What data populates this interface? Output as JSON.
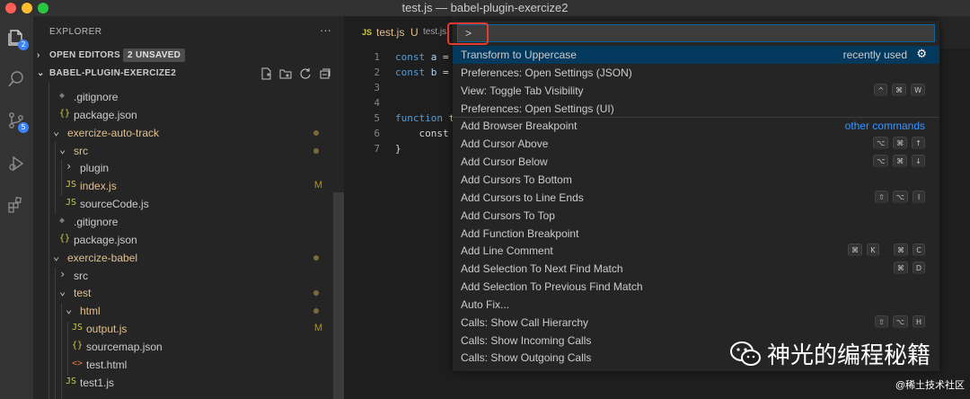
{
  "window": {
    "title": "test.js — babel-plugin-exercize2"
  },
  "activity_bar": {
    "explorer_badge": "2",
    "scm_badge": "5"
  },
  "sidebar": {
    "header": "EXPLORER",
    "more": "···",
    "open_editors": {
      "label": "OPEN EDITORS",
      "badge": "2 UNSAVED"
    },
    "project": {
      "label": "BABEL-PLUGIN-EXERCIZE2"
    },
    "tree": [
      {
        "name": ".gitignore",
        "icon": "◆",
        "icon_color": "#7a7a7a",
        "depth": 1,
        "color": "#cccccc"
      },
      {
        "name": "package.json",
        "icon": "{}",
        "icon_color": "#cbcb41",
        "depth": 1,
        "color": "#cccccc"
      },
      {
        "name": "exercize-auto-track",
        "icon": "⌄",
        "icon_color": "#cccccc",
        "depth": 0,
        "color": "#e2c08d",
        "dot": true
      },
      {
        "name": "src",
        "icon": "⌄",
        "icon_color": "#cccccc",
        "depth": 1,
        "color": "#e2c08d",
        "dot": true
      },
      {
        "name": "plugin",
        "icon": "›",
        "icon_color": "#cccccc",
        "depth": 2,
        "color": "#cccccc"
      },
      {
        "name": "index.js",
        "icon": "JS",
        "icon_color": "#cbcb41",
        "depth": 2,
        "color": "#e2c08d",
        "mark": "M"
      },
      {
        "name": "sourceCode.js",
        "icon": "JS",
        "icon_color": "#cbcb41",
        "depth": 2,
        "color": "#cccccc"
      },
      {
        "name": ".gitignore",
        "icon": "◆",
        "icon_color": "#7a7a7a",
        "depth": 1,
        "color": "#cccccc"
      },
      {
        "name": "package.json",
        "icon": "{}",
        "icon_color": "#cbcb41",
        "depth": 1,
        "color": "#cccccc"
      },
      {
        "name": "exercize-babel",
        "icon": "⌄",
        "icon_color": "#cccccc",
        "depth": 0,
        "color": "#e2c08d",
        "dot": true
      },
      {
        "name": "src",
        "icon": "›",
        "icon_color": "#cccccc",
        "depth": 1,
        "color": "#cccccc"
      },
      {
        "name": "test",
        "icon": "⌄",
        "icon_color": "#cccccc",
        "depth": 1,
        "color": "#e2c08d",
        "dot": true
      },
      {
        "name": "html",
        "icon": "⌄",
        "icon_color": "#cccccc",
        "depth": 2,
        "color": "#e2c08d",
        "dot": true
      },
      {
        "name": "output.js",
        "icon": "JS",
        "icon_color": "#cbcb41",
        "depth": 3,
        "color": "#e2c08d",
        "mark": "M"
      },
      {
        "name": "sourcemap.json",
        "icon": "{}",
        "icon_color": "#cbcb41",
        "depth": 3,
        "color": "#cccccc"
      },
      {
        "name": "test.html",
        "icon": "<>",
        "icon_color": "#e37933",
        "depth": 3,
        "color": "#cccccc"
      },
      {
        "name": "test1.js",
        "icon": "JS",
        "icon_color": "#cbcb41",
        "depth": 2,
        "color": "#cccccc"
      }
    ]
  },
  "editor": {
    "tab": {
      "filename": "test.js",
      "status": "U",
      "breadcrumb": "test.js"
    },
    "lines": [
      {
        "n": "1",
        "code": "const a ="
      },
      {
        "n": "2",
        "code": "const b ="
      },
      {
        "n": "3",
        "code": ""
      },
      {
        "n": "4",
        "code": ""
      },
      {
        "n": "5",
        "code": "function t"
      },
      {
        "n": "6",
        "code": "    const"
      },
      {
        "n": "7",
        "code": "}"
      }
    ]
  },
  "palette": {
    "input_value": ">",
    "items": [
      {
        "label": "Transform to Uppercase",
        "right": "recently used",
        "selected": true,
        "gear": true
      },
      {
        "label": "Preferences: Open Settings (JSON)"
      },
      {
        "label": "View: Toggle Tab Visibility",
        "keys": [
          [
            "^",
            "⌘",
            "W"
          ]
        ]
      },
      {
        "label": "Preferences: Open Settings (UI)"
      },
      {
        "label": "Add Browser Breakpoint",
        "right": "other commands",
        "separator": true
      },
      {
        "label": "Add Cursor Above",
        "keys": [
          [
            "⌥",
            "⌘",
            "↑"
          ]
        ]
      },
      {
        "label": "Add Cursor Below",
        "keys": [
          [
            "⌥",
            "⌘",
            "↓"
          ]
        ]
      },
      {
        "label": "Add Cursors To Bottom"
      },
      {
        "label": "Add Cursors to Line Ends",
        "keys": [
          [
            "⇧",
            "⌥",
            "I"
          ]
        ]
      },
      {
        "label": "Add Cursors To Top"
      },
      {
        "label": "Add Function Breakpoint"
      },
      {
        "label": "Add Line Comment",
        "keys": [
          [
            "⌘",
            "K"
          ],
          [
            "⌘",
            "C"
          ]
        ]
      },
      {
        "label": "Add Selection To Next Find Match",
        "keys": [
          [
            "⌘",
            "D"
          ]
        ]
      },
      {
        "label": "Add Selection To Previous Find Match"
      },
      {
        "label": "Auto Fix..."
      },
      {
        "label": "Calls: Show Call Hierarchy",
        "keys": [
          [
            "⇧",
            "⌥",
            "H"
          ]
        ]
      },
      {
        "label": "Calls: Show Incoming Calls"
      },
      {
        "label": "Calls: Show Outgoing Calls"
      }
    ]
  },
  "watermark": {
    "text": "神光的编程秘籍",
    "credit": "@稀土技术社区"
  }
}
